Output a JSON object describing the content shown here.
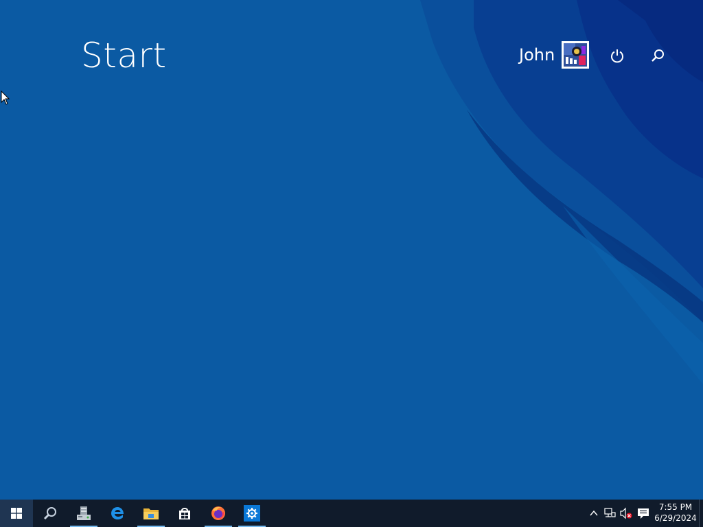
{
  "start_screen": {
    "title": "Start",
    "user": {
      "name": "John",
      "avatar_icon": "user-avatar-image"
    },
    "power_icon": "power-icon",
    "search_icon": "search-icon"
  },
  "colors": {
    "background": "#0b5aa3",
    "wave_dark": "#07328a",
    "taskbar": "#101b2b",
    "active_indicator": "#76b9ed",
    "text": "#ffffff"
  },
  "taskbar": {
    "start_button": "windows-logo-icon",
    "pinned": [
      {
        "name": "Search",
        "icon": "search-icon",
        "active": false
      },
      {
        "name": "Server Manager",
        "icon": "server-manager-icon",
        "active": true
      },
      {
        "name": "Microsoft Edge",
        "icon": "edge-icon",
        "active": false
      },
      {
        "name": "File Explorer",
        "icon": "folder-icon",
        "active": true
      },
      {
        "name": "Microsoft Store",
        "icon": "store-icon",
        "active": false
      },
      {
        "name": "Firefox",
        "icon": "firefox-icon",
        "active": true
      },
      {
        "name": "Settings",
        "icon": "gear-icon",
        "active": true
      }
    ],
    "tray": {
      "chevron": "chevron-up-icon",
      "network": "network-icon",
      "volume": "volume-muted-icon",
      "action_center": "action-center-icon"
    },
    "clock": {
      "time": "7:55 PM",
      "date": "6/29/2024"
    }
  }
}
